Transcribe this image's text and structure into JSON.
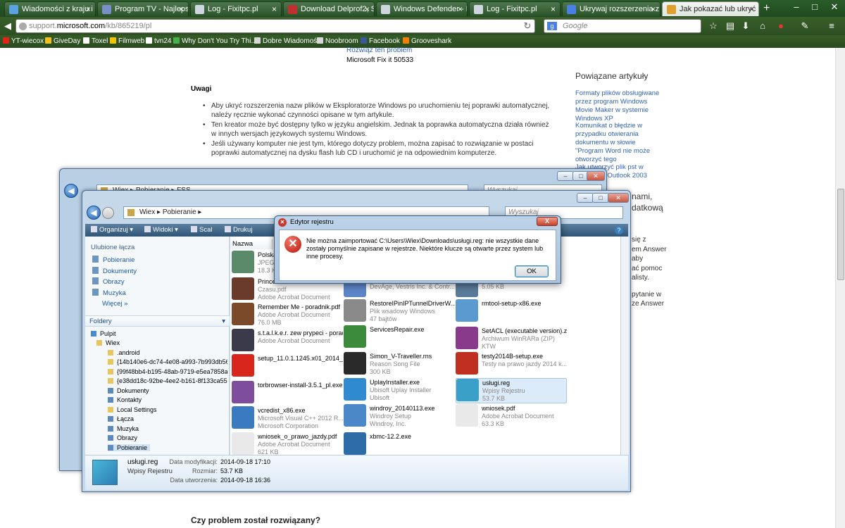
{
  "browser": {
    "tabs": [
      {
        "label": "Wiadomości z kraju i z..."
      },
      {
        "label": "Program TV - Najlepsz..."
      },
      {
        "label": "Log - Fixitpc.pl"
      },
      {
        "label": "Download Delprof2, Se..."
      },
      {
        "label": "Windows Defender - N..."
      },
      {
        "label": "Log - Fixitpc.pl"
      },
      {
        "label": "Ukrywaj rozszerzenia z..."
      },
      {
        "label": "Jak pokazać lub ukryć ..."
      }
    ],
    "new_tab": "+",
    "url_host": "support.",
    "url_domain": "microsoft.com",
    "url_path": "/kb/865219/pl",
    "search_engine": "g",
    "search_placeholder": "Google",
    "bookmarks": [
      {
        "label": "YT-wiecox",
        "color": "#e62117"
      },
      {
        "label": "GiveDay",
        "color": "#f0c020"
      },
      {
        "label": "Toxel",
        "color": "#ffffff"
      },
      {
        "label": "Filmweb",
        "color": "#f2c300"
      },
      {
        "label": "tvn24",
        "color": "#ffffff"
      },
      {
        "label": "Why Don't You Try Thi...",
        "color": "#47b04b"
      },
      {
        "label": "Dobre Wiadomości",
        "color": "#d8d8d8"
      },
      {
        "label": "Noobroom",
        "color": "#d8d8d8"
      },
      {
        "label": "Facebook",
        "color": "#3b5998"
      },
      {
        "label": "Grooveshark",
        "color": "#f77f00"
      }
    ]
  },
  "article": {
    "mf_link": "Rozwiąż ten problem",
    "mf_text": "Microsoft Fix it 50533",
    "notes_heading": "Uwagi",
    "notes": [
      "Aby ukryć rozszerzenia nazw plików w Eksploratorze Windows po uruchomieniu tej poprawki automatycznej, należy ręcznie wykonać czynności opisane w tym artykule.",
      "Ten kreator może być dostępny tylko w języku angielskim. Jednak ta poprawka automatyczna działa również w innych wersjach językowych systemu Windows.",
      "Jeśli używany komputer nie jest tym, którego dotyczy problem, można zapisać to rozwiązanie w postaci poprawki automatycznej na dysku flash lub CD i uruchomić je na odpowiednim komputerze."
    ],
    "related_title": "Powiązane artykuły",
    "related": [
      "Formaty plików obsługiwane przez program Windows Movie Maker w systemie Windows XP",
      "Komunikat o błędzie w przypadku otwierania dokumentu w słowie \"Program Word nie może otworzyć tego",
      "Jak utworzyć plik pst w programie Outlook 2003"
    ],
    "side_fragments": [
      "nami,",
      "datkową",
      "się z",
      "em Answer",
      "aby",
      "ać pomoc",
      "alisty.",
      "pytanie w",
      "ze Answer"
    ],
    "problem_heading": "Czy problem został rozwiązany?"
  },
  "explorer_back": {
    "path": [
      "Wiex",
      "Pobieranie",
      "FSS"
    ],
    "search_placeholder": "Wyszukaj"
  },
  "explorer": {
    "path": [
      "Wiex",
      "Pobieranie"
    ],
    "search_placeholder": "Wyszukaj",
    "commands": [
      "Organizuj",
      "Widoki",
      "Scal",
      "Drukuj"
    ],
    "favorites_heading": "Ulubione łącza",
    "favorites": [
      "Pobieranie",
      "Dokumenty",
      "Obrazy",
      "Muzyka"
    ],
    "more": "Więcej",
    "folders_heading": "Foldery",
    "tree": [
      "Pulpit",
      "Wiex",
      ".android",
      "{14b140e6-dc74-4e08-a993-7b993db56",
      "{99f48bb4-b195-48ab-9719-e5ea7858a",
      "{e38dd18c-92be-4ee2-b161-8f133ca55",
      "Dokumenty",
      "Kontakty",
      "Local Settings",
      "Łącza",
      "Muzyka",
      "Obrazy",
      "Pobieranie"
    ],
    "column_name": "Nazwa",
    "files": [
      {
        "name": "Polska...",
        "type": "JPEG",
        "size": "18.3 K",
        "icon": "#5a8a6a"
      },
      {
        "name": "Prince",
        "type": "Czasu.pdf",
        "size": "Adobe Acrobat Document",
        "icon": "#6a3a2a"
      },
      {
        "name": "Remember Me - poradnik.pdf",
        "type": "Adobe Acrobat Document",
        "size": "76.0 MB",
        "icon": "#7a4a2a"
      },
      {
        "name": "s.t.a.l.k.e.r. zew prypeci - poradnik.pdf",
        "type": "Adobe Acrobat Document",
        "size": "",
        "icon": "#3a3a4a"
      },
      {
        "name": "setup_11.0.1.1245.x01_2014_...",
        "type": "",
        "size": "",
        "icon": "#d9261c"
      },
      {
        "name": "torbrowser-install-3.5.1_pl.exe",
        "type": "",
        "size": "",
        "icon": "#7e4d9c"
      },
      {
        "name": "vcredist_x86.exe",
        "type": "Microsoft Visual C++ 2012 R...",
        "size": "Microsoft Corporation",
        "icon": "#3a7ac0"
      },
      {
        "name": "wniosek_o_prawo_jazdy.pdf",
        "type": "Adobe Acrobat Document",
        "size": "621 KB",
        "icon": "#e9e9e9"
      },
      {
        "name": "PrivacyProtectorUninstaller",
        "type": "DevAge, Vestris Inc. & Contr...",
        "size": "",
        "icon": "#5c86c8"
      },
      {
        "name": "RestoreIPinIPTunnelDriverW...",
        "type": "Plik wsadowy Windows",
        "size": "47 bajtów",
        "icon": "#8a8a8a"
      },
      {
        "name": "ServicesRepair.exe",
        "type": "",
        "size": "",
        "icon": "#3c8a3c"
      },
      {
        "name": "Simon_V-Traveller.rns",
        "type": "Reason Song File",
        "size": "300 KB",
        "icon": "#2a2a2a"
      },
      {
        "name": "UplayInstaller.exe",
        "type": "Ubisoft Uplay Installer",
        "size": "Ubisoft",
        "icon": "#2f8ad0"
      },
      {
        "name": "windroy_20140113.exe",
        "type": "Windroy Setup",
        "size": "Windroy, Inc.",
        "icon": "#4a88c8"
      },
      {
        "name": "xbmc-12.2.exe",
        "type": "",
        "size": "",
        "icon": "#2e6ca8"
      },
      {
        "name": "Plik informacji o systemie",
        "type": "5.05 KB",
        "size": "",
        "icon": "#5a7a9a"
      },
      {
        "name": "rmtool-setup-x86.exe",
        "type": "",
        "size": "",
        "icon": "#5a9ad0"
      },
      {
        "name": "SetACL (executable version).zip",
        "type": "Archiwum WinRARa (ZIP)",
        "size": "KTW",
        "icon": "#8a3a8a"
      },
      {
        "name": "testy2014B-setup.exe",
        "type": "Testy na prawo jazdy 2014 k...",
        "size": "",
        "icon": "#c03020"
      },
      {
        "name": "usługi.reg",
        "type": "Wpisy Rejestru",
        "size": "53.7 KB",
        "icon": "#3aa0c8"
      },
      {
        "name": "wniosek.pdf",
        "type": "Adobe Acrobat Document",
        "size": "63.3 KB",
        "icon": "#e9e9e9"
      }
    ],
    "details": {
      "name": "usługi.reg",
      "type": "Wpisy Rejestru",
      "modified_label": "Data modyfikacji:",
      "modified": "2014-09-18 17:10",
      "size_label": "Rozmiar:",
      "size": "53.7 KB",
      "created_label": "Data utworzenia:",
      "created": "2014-09-18 16:36"
    }
  },
  "dialog": {
    "title": "Edytor rejestru",
    "message": "Nie można zaimportować C:\\Users\\Wiex\\Downloads\\usługi.reg: nie wszystkie dane zostały pomyślnie zapisane w rejestrze. Niektóre klucze są otwarte przez system lub inne procesy.",
    "ok": "OK",
    "close": "X"
  }
}
